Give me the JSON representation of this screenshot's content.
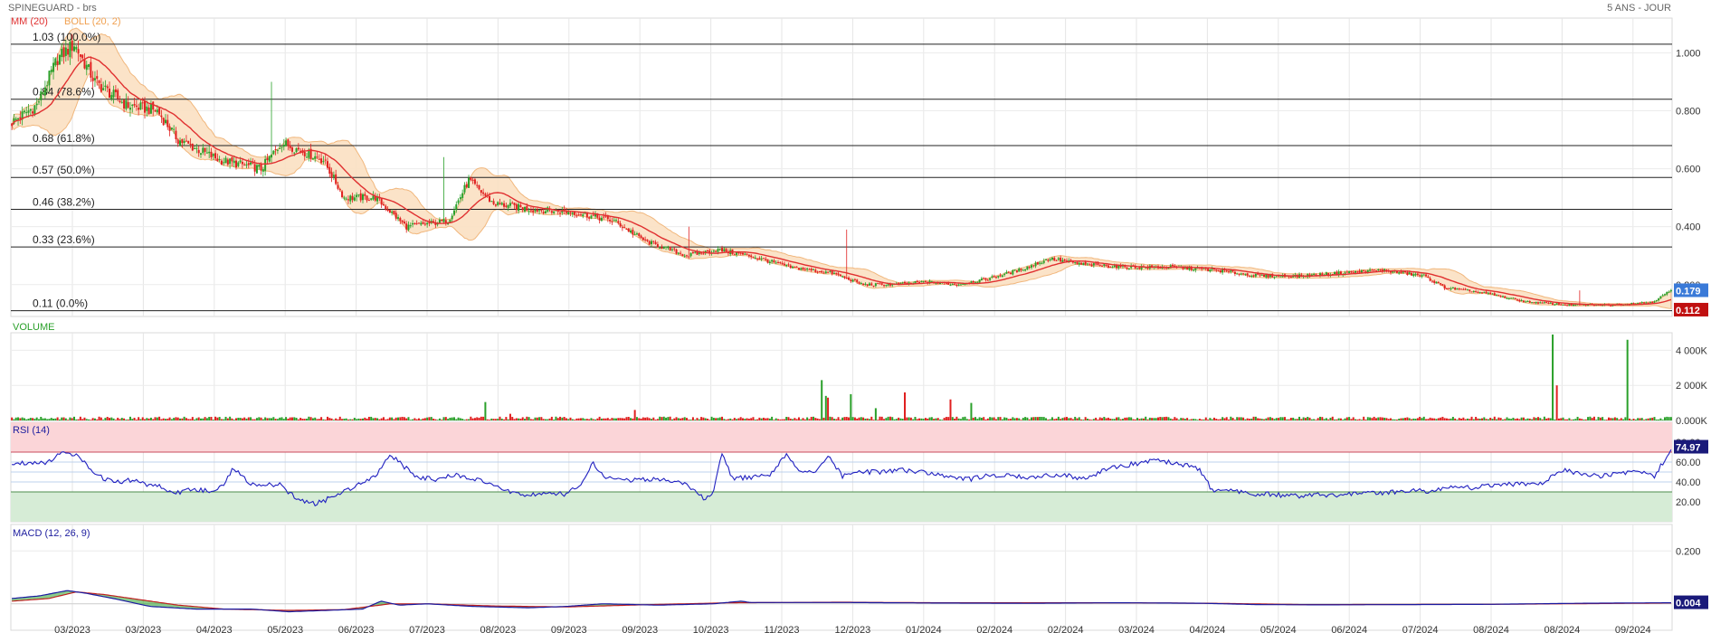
{
  "header": {
    "title": "SPINEGUARD - brs",
    "period": "5 ANS - JOUR",
    "mm_label": "MM (20)",
    "boll_label": "BOLL (20, 2)",
    "volume_label": "VOLUME",
    "rsi_label": "RSI (14)",
    "macd_label": "MACD (12, 26, 9)"
  },
  "colors": {
    "up": "#2aa02a",
    "down": "#e02020",
    "ma": "#e03030",
    "boll_fill": "#fbe1c3",
    "boll_line": "#f0b070",
    "rsi": "#2020c0",
    "macd": "#1a1aa0",
    "signal": "#c02020",
    "hist": "#2aa02a",
    "last_badge": "#3a7ad8",
    "low_badge": "#c01010",
    "rsi_over": "#fbd5d8",
    "rsi_under": "#d6ecd6"
  },
  "chart_data": [
    {
      "type": "candlestick",
      "name": "price",
      "x_ticks": [
        "03/2023",
        "03/2023",
        "04/2023",
        "05/2023",
        "06/2023",
        "07/2023",
        "08/2023",
        "09/2023",
        "09/2023",
        "10/2023",
        "11/2023",
        "12/2023",
        "01/2024",
        "02/2024",
        "02/2024",
        "03/2024",
        "04/2024",
        "05/2024",
        "06/2024",
        "07/2024",
        "08/2024",
        "08/2024",
        "09/2024"
      ],
      "y_ticks": [
        "1.000",
        "0.800",
        "0.600",
        "0.400",
        "0.200"
      ],
      "ylim": [
        0.09,
        1.12
      ],
      "price_keypoints": [
        [
          0,
          0.76
        ],
        [
          12,
          0.82
        ],
        [
          22,
          0.98
        ],
        [
          30,
          1.03
        ],
        [
          40,
          0.9
        ],
        [
          55,
          0.82
        ],
        [
          70,
          0.8
        ],
        [
          80,
          0.7
        ],
        [
          100,
          0.63
        ],
        [
          120,
          0.6
        ],
        [
          130,
          0.69
        ],
        [
          150,
          0.63
        ],
        [
          160,
          0.5
        ],
        [
          175,
          0.5
        ],
        [
          190,
          0.4
        ],
        [
          210,
          0.42
        ],
        [
          220,
          0.56
        ],
        [
          232,
          0.48
        ],
        [
          250,
          0.46
        ],
        [
          270,
          0.45
        ],
        [
          290,
          0.42
        ],
        [
          305,
          0.35
        ],
        [
          325,
          0.3
        ],
        [
          340,
          0.32
        ],
        [
          355,
          0.3
        ],
        [
          375,
          0.26
        ],
        [
          395,
          0.24
        ],
        [
          410,
          0.2
        ],
        [
          425,
          0.2
        ],
        [
          440,
          0.21
        ],
        [
          455,
          0.2
        ],
        [
          470,
          0.22
        ],
        [
          485,
          0.25
        ],
        [
          500,
          0.29
        ],
        [
          515,
          0.27
        ],
        [
          540,
          0.26
        ],
        [
          560,
          0.26
        ],
        [
          580,
          0.25
        ],
        [
          600,
          0.23
        ],
        [
          620,
          0.23
        ],
        [
          640,
          0.24
        ],
        [
          660,
          0.25
        ],
        [
          680,
          0.23
        ],
        [
          690,
          0.19
        ],
        [
          710,
          0.17
        ],
        [
          730,
          0.14
        ],
        [
          750,
          0.13
        ],
        [
          770,
          0.13
        ],
        [
          790,
          0.14
        ],
        [
          799,
          0.18
        ]
      ],
      "fibonacci": [
        {
          "price": 1.03,
          "label": "1.03 (100.0%)"
        },
        {
          "price": 0.84,
          "label": "0.84 (78.6%)"
        },
        {
          "price": 0.68,
          "label": "0.68 (61.8%)"
        },
        {
          "price": 0.57,
          "label": "0.57 (50.0%)"
        },
        {
          "price": 0.46,
          "label": "0.46 (38.2%)"
        },
        {
          "price": 0.33,
          "label": "0.33 (23.6%)"
        },
        {
          "price": 0.11,
          "label": "0.11 (0.0%)"
        }
      ],
      "last_price": {
        "value": 0.179,
        "label": "0.179"
      },
      "low_price": {
        "value": 0.112,
        "label": "0.112"
      }
    },
    {
      "type": "bar",
      "name": "volume",
      "y_ticks": [
        "4 000K",
        "2 000K",
        "0.000K"
      ],
      "ylim": [
        0,
        5000
      ],
      "spikes": [
        [
          0.3,
          380,
          "down"
        ],
        [
          0.285,
          1050,
          "up"
        ],
        [
          0.375,
          600,
          "down"
        ],
        [
          0.505,
          1500,
          "up"
        ],
        [
          0.491,
          1300,
          "down"
        ],
        [
          0.52,
          700,
          "up"
        ],
        [
          0.538,
          1600,
          "down"
        ],
        [
          0.487,
          2300,
          "up"
        ],
        [
          0.49,
          1400,
          "up"
        ],
        [
          0.565,
          1200,
          "down"
        ],
        [
          0.577,
          1000,
          "up"
        ],
        [
          0.927,
          4900,
          "up"
        ],
        [
          0.93,
          2000,
          "down"
        ],
        [
          0.972,
          4600,
          "up"
        ]
      ]
    },
    {
      "type": "line",
      "name": "rsi",
      "y_ticks": [
        "80.00",
        "60.00",
        "40.00",
        "20.00"
      ],
      "ylim": [
        0,
        100
      ],
      "overbought": 70,
      "oversold": 30,
      "last": {
        "value": 74.97,
        "label": "74.97"
      },
      "keypoints": [
        [
          0,
          58
        ],
        [
          20,
          60
        ],
        [
          38,
          60
        ],
        [
          45,
          62
        ],
        [
          55,
          72
        ],
        [
          62,
          70
        ],
        [
          70,
          66
        ],
        [
          80,
          58
        ],
        [
          90,
          50
        ],
        [
          100,
          43
        ],
        [
          115,
          40
        ],
        [
          130,
          42
        ],
        [
          145,
          38
        ],
        [
          160,
          36
        ],
        [
          175,
          28
        ],
        [
          195,
          33
        ],
        [
          215,
          30
        ],
        [
          232,
          40
        ],
        [
          240,
          55
        ],
        [
          255,
          40
        ],
        [
          270,
          37
        ],
        [
          290,
          37
        ],
        [
          310,
          22
        ],
        [
          330,
          18
        ],
        [
          350,
          26
        ],
        [
          380,
          40
        ],
        [
          395,
          48
        ],
        [
          410,
          68
        ],
        [
          425,
          55
        ],
        [
          440,
          45
        ],
        [
          460,
          42
        ],
        [
          480,
          47
        ],
        [
          500,
          44
        ],
        [
          520,
          36
        ],
        [
          540,
          30
        ],
        [
          560,
          27
        ],
        [
          580,
          28
        ],
        [
          600,
          28
        ],
        [
          620,
          40
        ],
        [
          630,
          60
        ],
        [
          640,
          46
        ],
        [
          660,
          42
        ],
        [
          680,
          42
        ],
        [
          700,
          43
        ],
        [
          725,
          40
        ],
        [
          740,
          30
        ],
        [
          750,
          24
        ],
        [
          760,
          29
        ],
        [
          770,
          70
        ],
        [
          780,
          44
        ],
        [
          800,
          44
        ],
        [
          820,
          46
        ],
        [
          840,
          68
        ],
        [
          855,
          50
        ],
        [
          870,
          50
        ],
        [
          885,
          66
        ],
        [
          900,
          45
        ],
        [
          915,
          50
        ],
        [
          940,
          50
        ],
        [
          960,
          52
        ],
        [
          980,
          50
        ],
        [
          1000,
          48
        ],
        [
          1020,
          44
        ],
        [
          1040,
          43
        ],
        [
          1060,
          47
        ],
        [
          1080,
          46
        ],
        [
          1100,
          44
        ],
        [
          1120,
          46
        ],
        [
          1140,
          48
        ],
        [
          1160,
          43
        ],
        [
          1180,
          50
        ],
        [
          1200,
          56
        ],
        [
          1220,
          59
        ],
        [
          1240,
          61
        ],
        [
          1260,
          59
        ],
        [
          1280,
          56
        ],
        [
          1290,
          49
        ],
        [
          1300,
          32
        ],
        [
          1320,
          31
        ],
        [
          1340,
          28
        ],
        [
          1360,
          28
        ],
        [
          1380,
          26
        ],
        [
          1400,
          26
        ],
        [
          1420,
          27
        ],
        [
          1440,
          26
        ],
        [
          1460,
          29
        ],
        [
          1480,
          28
        ],
        [
          1500,
          30
        ],
        [
          1520,
          32
        ],
        [
          1540,
          30
        ],
        [
          1560,
          36
        ],
        [
          1580,
          34
        ],
        [
          1600,
          36
        ],
        [
          1620,
          38
        ],
        [
          1640,
          38
        ],
        [
          1660,
          40
        ],
        [
          1680,
          52
        ],
        [
          1700,
          48
        ],
        [
          1720,
          46
        ],
        [
          1740,
          48
        ],
        [
          1760,
          50
        ],
        [
          1780,
          46
        ],
        [
          1799,
          75
        ]
      ]
    },
    {
      "type": "line",
      "name": "macd",
      "y_ticks": [
        "0.200"
      ],
      "ylim": [
        -0.1,
        0.3
      ],
      "last": {
        "value": 0.004,
        "label": "0.004"
      },
      "macd_keypoints": [
        [
          0,
          0.02
        ],
        [
          30,
          0.03
        ],
        [
          60,
          0.05
        ],
        [
          80,
          0.04
        ],
        [
          110,
          0.02
        ],
        [
          150,
          -0.01
        ],
        [
          200,
          -0.02
        ],
        [
          260,
          -0.02
        ],
        [
          300,
          -0.03
        ],
        [
          340,
          -0.025
        ],
        [
          380,
          -0.02
        ],
        [
          400,
          0.01
        ],
        [
          420,
          -0.005
        ],
        [
          450,
          0.0
        ],
        [
          500,
          -0.01
        ],
        [
          560,
          -0.015
        ],
        [
          600,
          -0.01
        ],
        [
          640,
          0.0
        ],
        [
          700,
          -0.005
        ],
        [
          760,
          0.0
        ],
        [
          790,
          0.01
        ],
        [
          800,
          0.005
        ],
        [
          900,
          0.005
        ],
        [
          1000,
          0.003
        ],
        [
          1100,
          0.002
        ],
        [
          1200,
          0.004
        ],
        [
          1290,
          0.002
        ],
        [
          1350,
          -0.003
        ],
        [
          1420,
          -0.004
        ],
        [
          1500,
          -0.003
        ],
        [
          1600,
          -0.002
        ],
        [
          1700,
          0.002
        ],
        [
          1799,
          0.004
        ]
      ],
      "signal_keypoints": [
        [
          0,
          0.01
        ],
        [
          40,
          0.02
        ],
        [
          70,
          0.045
        ],
        [
          100,
          0.035
        ],
        [
          140,
          0.015
        ],
        [
          180,
          -0.005
        ],
        [
          230,
          -0.02
        ],
        [
          300,
          -0.025
        ],
        [
          360,
          -0.022
        ],
        [
          410,
          0.0
        ],
        [
          450,
          0.0
        ],
        [
          520,
          -0.008
        ],
        [
          600,
          -0.012
        ],
        [
          680,
          -0.004
        ],
        [
          780,
          0.004
        ],
        [
          900,
          0.006
        ],
        [
          1000,
          0.004
        ],
        [
          1200,
          0.004
        ],
        [
          1300,
          0.002
        ],
        [
          1400,
          -0.003
        ],
        [
          1600,
          -0.002
        ],
        [
          1799,
          0.003
        ]
      ]
    }
  ]
}
